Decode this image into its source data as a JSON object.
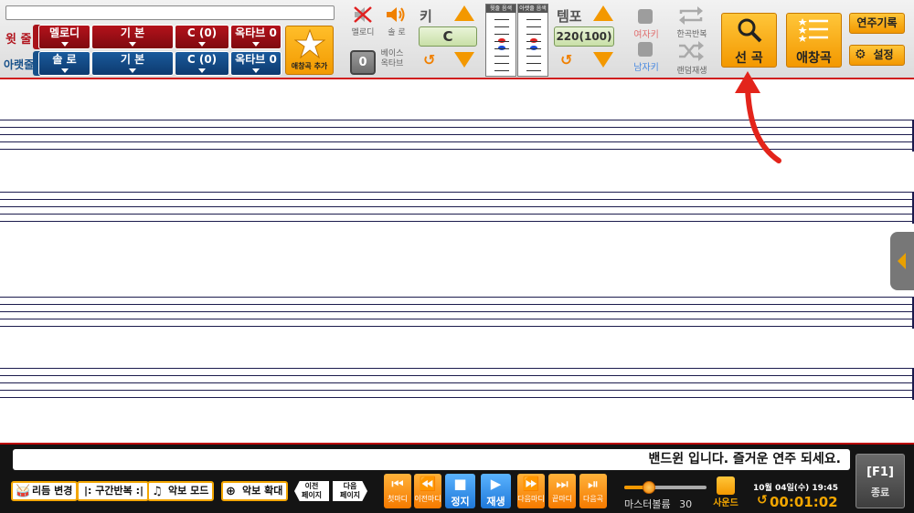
{
  "top": {
    "upper_row_label": "윗 줄",
    "lower_row_label": "아랫줄",
    "upper_row": [
      "멜로디",
      "기 본",
      "C (0)",
      "옥타브 0"
    ],
    "lower_row": [
      "솔 로",
      "기 본",
      "C (0)",
      "옥타브 0"
    ],
    "fav_add_label": "애창곡 추가",
    "melody_label": "멜로디",
    "solo_label": "솔 로",
    "octave_value": "0",
    "bass_octave_label": "베이스\n옥타브",
    "key_title": "키",
    "key_value": "C",
    "pan_upper_label": "윗줄 음색",
    "pan_lower_label": "아랫줄 음색",
    "tempo_title": "템포",
    "tempo_value": "220(100)",
    "female_key": "여자키",
    "male_key": "남자키",
    "repeat_one": "한곡반복",
    "random_play": "랜덤재생",
    "select_song": "선 곡",
    "favorites": "애창곡",
    "play_history": "연주기록",
    "settings": "설정"
  },
  "colors": {
    "upper_row": "#a8121a",
    "lower_row": "#16508a",
    "accent": "#f39800",
    "annotation_arrow": "#e3241b"
  },
  "bottom": {
    "message": "밴드윈 입니다. 즐거운 연주 되세요.",
    "rhythm_change": "리듬 변경",
    "section_repeat": "구간반복",
    "score_mode": "악보 모드",
    "score_zoom": "악보 확대",
    "prev_page": "이전\n페이지",
    "next_page": "다음\n페이지",
    "transport": [
      {
        "icon": "first-measure-icon",
        "label": "첫마디"
      },
      {
        "icon": "prev-measure-icon",
        "label": "이전마디"
      },
      {
        "icon": "stop-icon",
        "label": "정지"
      },
      {
        "icon": "play-icon",
        "label": "재생"
      },
      {
        "icon": "next-measure-icon",
        "label": "다음마디"
      },
      {
        "icon": "last-measure-icon",
        "label": "끝마디"
      },
      {
        "icon": "next-song-icon",
        "label": "다음곡"
      }
    ],
    "master_volume_label": "마스터볼륨",
    "master_volume_value": "30",
    "sound": "사운드",
    "date": "10월 04일(수) 19:45",
    "elapsed": "00:01:02",
    "exit_key": "[F1]",
    "exit_label": "종료"
  }
}
